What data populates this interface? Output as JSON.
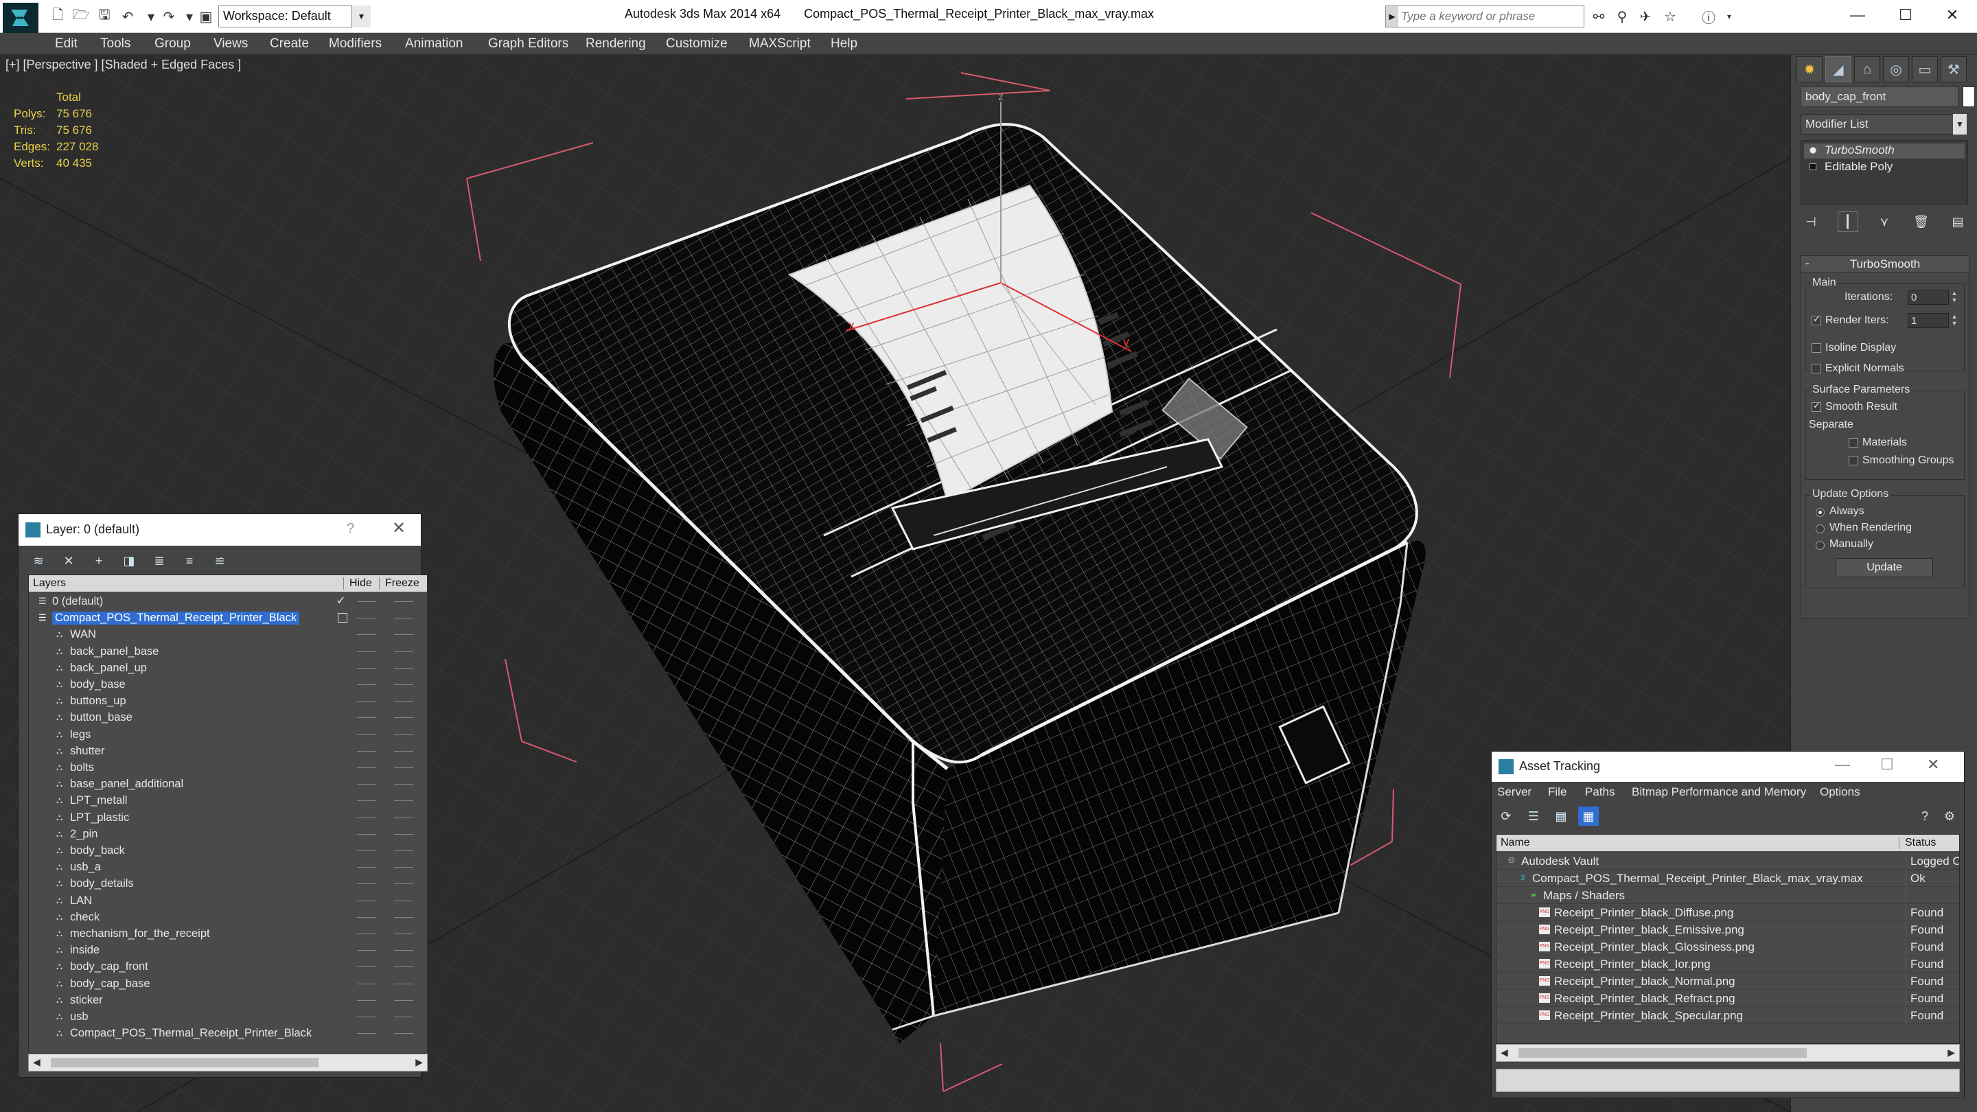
{
  "titlebar": {
    "workspace": "Workspace: Default",
    "app_title": "Autodesk 3ds Max  2014 x64",
    "file_title": "Compact_POS_Thermal_Receipt_Printer_Black_max_vray.max",
    "search_placeholder": "Type a keyword or phrase",
    "minimize_glyph": "—",
    "maximize_glyph": "☐",
    "close_glyph": "✕"
  },
  "menu": [
    "Edit",
    "Tools",
    "Group",
    "Views",
    "Create",
    "Modifiers",
    "Animation",
    "Graph Editors",
    "Rendering",
    "Customize",
    "MAXScript",
    "Help"
  ],
  "viewport": {
    "label": "[+] [Perspective ] [Shaded + Edged Faces ]",
    "stats": {
      "header": "Total",
      "rows": [
        {
          "k": "Polys:",
          "v": "75 676"
        },
        {
          "k": "Tris:",
          "v": "75 676"
        },
        {
          "k": "Edges:",
          "v": "227 028"
        },
        {
          "k": "Verts:",
          "v": "40 435"
        }
      ]
    },
    "axis_x": "x",
    "axis_y": "y",
    "axis_z": "z"
  },
  "command_panel": {
    "object_name": "body_cap_front",
    "modifier_list": "Modifier List",
    "stack": [
      "TurboSmooth",
      "Editable Poly"
    ],
    "rollout_title": "TurboSmooth",
    "main_group": "Main",
    "iterations_label": "Iterations:",
    "iterations_value": "0",
    "render_iters_label": "Render Iters:",
    "render_iters_value": "1",
    "isoline": "Isoline Display",
    "explicit_normals": "Explicit Normals",
    "surface_group": "Surface Parameters",
    "smooth_result": "Smooth Result",
    "separate": "Separate",
    "materials": "Materials",
    "smoothing_groups": "Smoothing Groups",
    "update_group": "Update Options",
    "always": "Always",
    "when_rendering": "When Rendering",
    "manually": "Manually",
    "update_button": "Update"
  },
  "layer_panel": {
    "title": "Layer: 0 (default)",
    "help": "?",
    "close": "✕",
    "col_layers": "Layers",
    "col_hide": "Hide",
    "col_freeze": "Freeze",
    "default_layer": "0 (default)",
    "selected_layer": "Compact_POS_Thermal_Receipt_Printer_Black",
    "objects": [
      "WAN",
      "back_panel_base",
      "back_panel_up",
      "body_base",
      "buttons_up",
      "button_base",
      "legs",
      "shutter",
      "bolts",
      "base_panel_additional",
      "LPT_metall",
      "LPT_plastic",
      "2_pin",
      "body_back",
      "usb_a",
      "body_details",
      "LAN",
      "check",
      "mechanism_for_the_receipt",
      "inside",
      "body_cap_front",
      "body_cap_base",
      "sticker",
      "usb",
      "Compact_POS_Thermal_Receipt_Printer_Black"
    ]
  },
  "asset_tracking": {
    "title": "Asset Tracking",
    "menu": [
      "Server",
      "File",
      "Paths",
      "Bitmap Performance and Memory",
      "Options"
    ],
    "col_name": "Name",
    "col_status": "Status",
    "rows": [
      {
        "name": "Autodesk Vault",
        "status": "Logged Out",
        "kind": "vault"
      },
      {
        "name": "Compact_POS_Thermal_Receipt_Printer_Black_max_vray.max",
        "status": "Ok",
        "kind": "max"
      },
      {
        "name": "Maps / Shaders",
        "status": "",
        "kind": "folder"
      },
      {
        "name": "Receipt_Printer_black_Diffuse.png",
        "status": "Found",
        "kind": "png"
      },
      {
        "name": "Receipt_Printer_black_Emissive.png",
        "status": "Found",
        "kind": "png"
      },
      {
        "name": "Receipt_Printer_black_Glossiness.png",
        "status": "Found",
        "kind": "png"
      },
      {
        "name": "Receipt_Printer_black_Ior.png",
        "status": "Found",
        "kind": "png"
      },
      {
        "name": "Receipt_Printer_black_Normal.png",
        "status": "Found",
        "kind": "png"
      },
      {
        "name": "Receipt_Printer_black_Refract.png",
        "status": "Found",
        "kind": "png"
      },
      {
        "name": "Receipt_Printer_black_Specular.png",
        "status": "Found",
        "kind": "png"
      }
    ]
  },
  "colors": {
    "selection": "#2f6ed0",
    "stats_text": "#e8d248",
    "bbox_bracket": "#d85a6e",
    "panel_bg": "#444444"
  }
}
